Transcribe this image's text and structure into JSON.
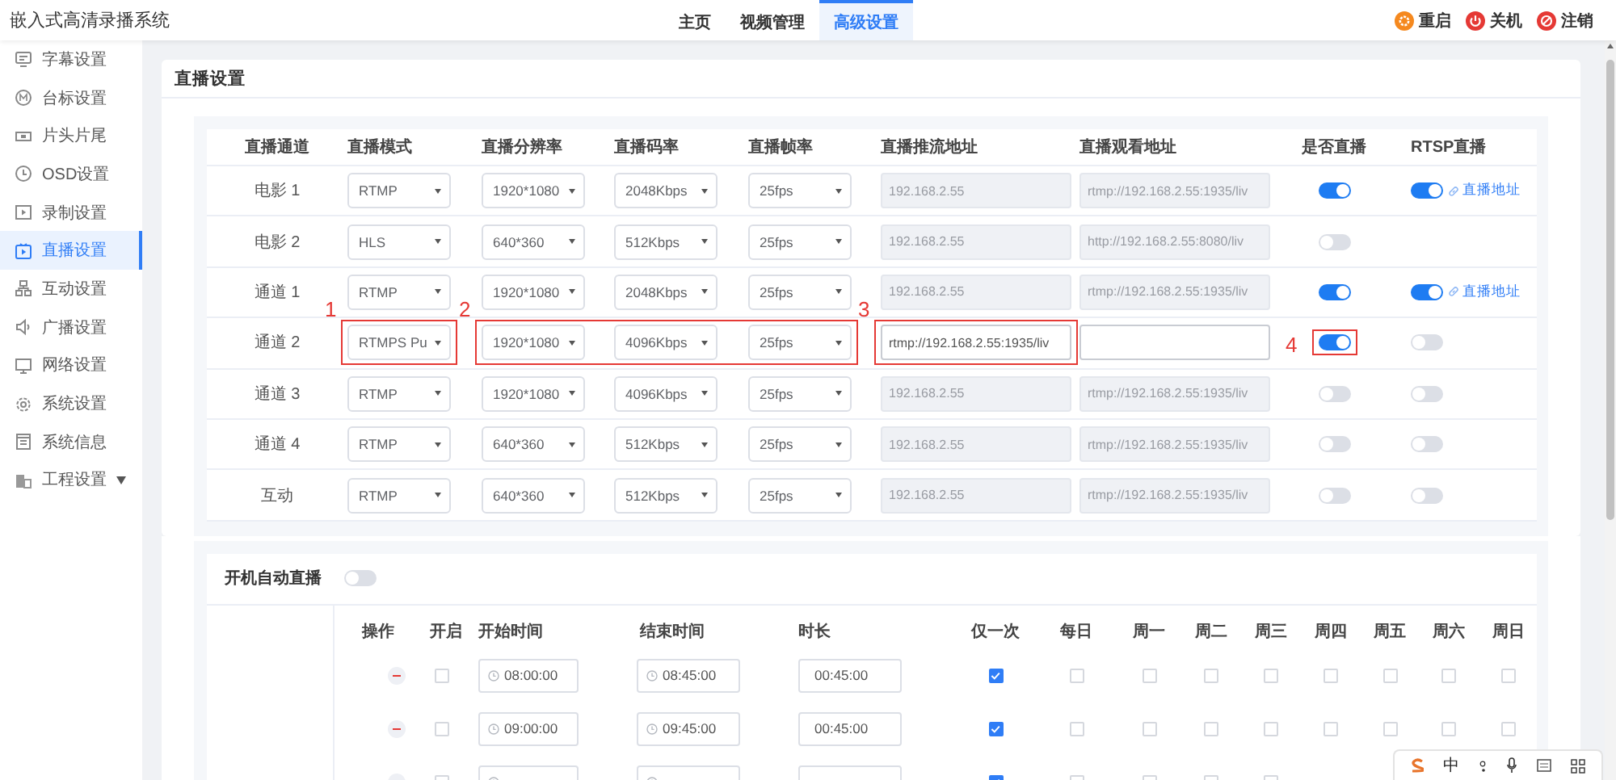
{
  "app": {
    "title": "嵌入式高清录播系统"
  },
  "nav_tabs": [
    {
      "label": "主页",
      "selected": false
    },
    {
      "label": "视频管理",
      "selected": false
    },
    {
      "label": "高级设置",
      "selected": true
    }
  ],
  "actions": [
    {
      "label": "重启"
    },
    {
      "label": "关机"
    },
    {
      "label": "注销"
    }
  ],
  "sidebar": {
    "items": [
      {
        "label": "字幕设置",
        "selected": false,
        "kind": "link"
      },
      {
        "label": "台标设置",
        "selected": false,
        "kind": "link"
      },
      {
        "label": "片头片尾",
        "selected": false,
        "kind": "link"
      },
      {
        "label": "OSD设置",
        "selected": false,
        "kind": "link"
      },
      {
        "label": "录制设置",
        "selected": false,
        "kind": "link"
      },
      {
        "label": "直播设置",
        "selected": true,
        "kind": "link"
      },
      {
        "label": "互动设置",
        "selected": false,
        "kind": "link"
      },
      {
        "label": "广播设置",
        "selected": false,
        "kind": "link"
      },
      {
        "label": "网络设置",
        "selected": false,
        "kind": "link"
      },
      {
        "label": "系统设置",
        "selected": false,
        "kind": "link"
      },
      {
        "label": "系统信息",
        "selected": false,
        "kind": "link"
      },
      {
        "label": "工程设置",
        "selected": false,
        "kind": "group"
      }
    ]
  },
  "live_settings": {
    "title": "直播设置",
    "columns": [
      "直播通道",
      "直播模式",
      "直播分辨率",
      "直播码率",
      "直播帧率",
      "直播推流地址",
      "直播观看地址",
      "是否直播",
      "RTSP直播"
    ],
    "rows": [
      {
        "channel": "电影 1",
        "mode": "RTMP",
        "resolution": "1920*1080",
        "bitrate": "2048Kbps",
        "fps": "25fps",
        "push_url": {
          "value": "192.168.2.55",
          "disabled": true
        },
        "view_url": {
          "value": "rtmp://192.168.2.55:1935/liv",
          "disabled": true
        },
        "live": true,
        "rtsp": {
          "on": true,
          "link": "直播地址"
        }
      },
      {
        "channel": "电影 2",
        "mode": "HLS",
        "resolution": "640*360",
        "bitrate": "512Kbps",
        "fps": "25fps",
        "push_url": {
          "value": "192.168.2.55",
          "disabled": true
        },
        "view_url": {
          "value": "http://192.168.2.55:8080/liv",
          "disabled": true
        },
        "live": false
      },
      {
        "channel": "通道 1",
        "mode": "RTMP",
        "resolution": "1920*1080",
        "bitrate": "2048Kbps",
        "fps": "25fps",
        "push_url": {
          "value": "192.168.2.55",
          "disabled": true
        },
        "view_url": {
          "value": "rtmp://192.168.2.55:1935/liv",
          "disabled": true
        },
        "live": true,
        "rtsp": {
          "on": true,
          "link": "直播地址"
        }
      },
      {
        "channel": "通道 2",
        "mode": "RTMPS Pu",
        "resolution": "1920*1080",
        "bitrate": "4096Kbps",
        "fps": "25fps",
        "push_url": {
          "value": "rtmp://192.168.2.55:1935/liv",
          "disabled": false
        },
        "view_url": {
          "disabled": false
        },
        "live": true,
        "rtsp": {
          "on": false
        },
        "mode_note": "1",
        "format_note": "2",
        "push_note": "3",
        "live_note": "4"
      },
      {
        "channel": "通道 3",
        "mode": "RTMP",
        "resolution": "1920*1080",
        "bitrate": "4096Kbps",
        "fps": "25fps",
        "push_url": {
          "value": "192.168.2.55",
          "disabled": true
        },
        "view_url": {
          "value": "rtmp://192.168.2.55:1935/liv",
          "disabled": true
        },
        "live": false,
        "rtsp": {
          "on": false
        }
      },
      {
        "channel": "通道 4",
        "mode": "RTMP",
        "resolution": "640*360",
        "bitrate": "512Kbps",
        "fps": "25fps",
        "push_url": {
          "value": "192.168.2.55",
          "disabled": true
        },
        "view_url": {
          "value": "rtmp://192.168.2.55:1935/liv",
          "disabled": true
        },
        "live": false,
        "rtsp": {
          "on": false
        }
      },
      {
        "channel": "互动",
        "mode": "RTMP",
        "resolution": "640*360",
        "bitrate": "512Kbps",
        "fps": "25fps",
        "push_url": {
          "value": "192.168.2.55",
          "disabled": true
        },
        "view_url": {
          "value": "rtmp://192.168.2.55:1935/liv",
          "disabled": true
        },
        "live": false,
        "rtsp": {
          "on": false
        }
      }
    ]
  },
  "auto_start": {
    "label": "开机自动直播",
    "on": false
  },
  "schedule": {
    "columns": [
      "操作",
      "开启",
      "开始时间",
      "结束时间",
      "时长",
      "仅一次",
      "每日",
      "周一",
      "周二",
      "周三",
      "周四",
      "周五",
      "周六",
      "周日"
    ],
    "rows": [
      {
        "on": false,
        "start": "08:00:00",
        "end": "08:45:00",
        "duration": "00:45:00",
        "days": [
          {
            "checked": true
          },
          {
            "checked": false
          },
          {
            "checked": false
          },
          {
            "checked": false
          },
          {
            "checked": false
          },
          {
            "checked": false
          },
          {
            "checked": false
          },
          {
            "checked": false
          },
          {
            "checked": false
          }
        ]
      },
      {
        "on": false,
        "start": "09:00:00",
        "end": "09:45:00",
        "duration": "00:45:00",
        "days": [
          {
            "checked": true
          },
          {
            "checked": false
          },
          {
            "checked": false
          },
          {
            "checked": false
          },
          {
            "checked": false
          },
          {
            "checked": false
          },
          {
            "checked": false
          },
          {
            "checked": false
          },
          {
            "checked": false
          }
        ]
      },
      {
        "on": false,
        "days": [
          {
            "checked": true
          },
          {
            "checked": false
          },
          {
            "checked": false
          },
          {
            "checked": false
          },
          {
            "checked": false
          }
        ]
      }
    ]
  },
  "ime_bar": {
    "label": "中"
  }
}
